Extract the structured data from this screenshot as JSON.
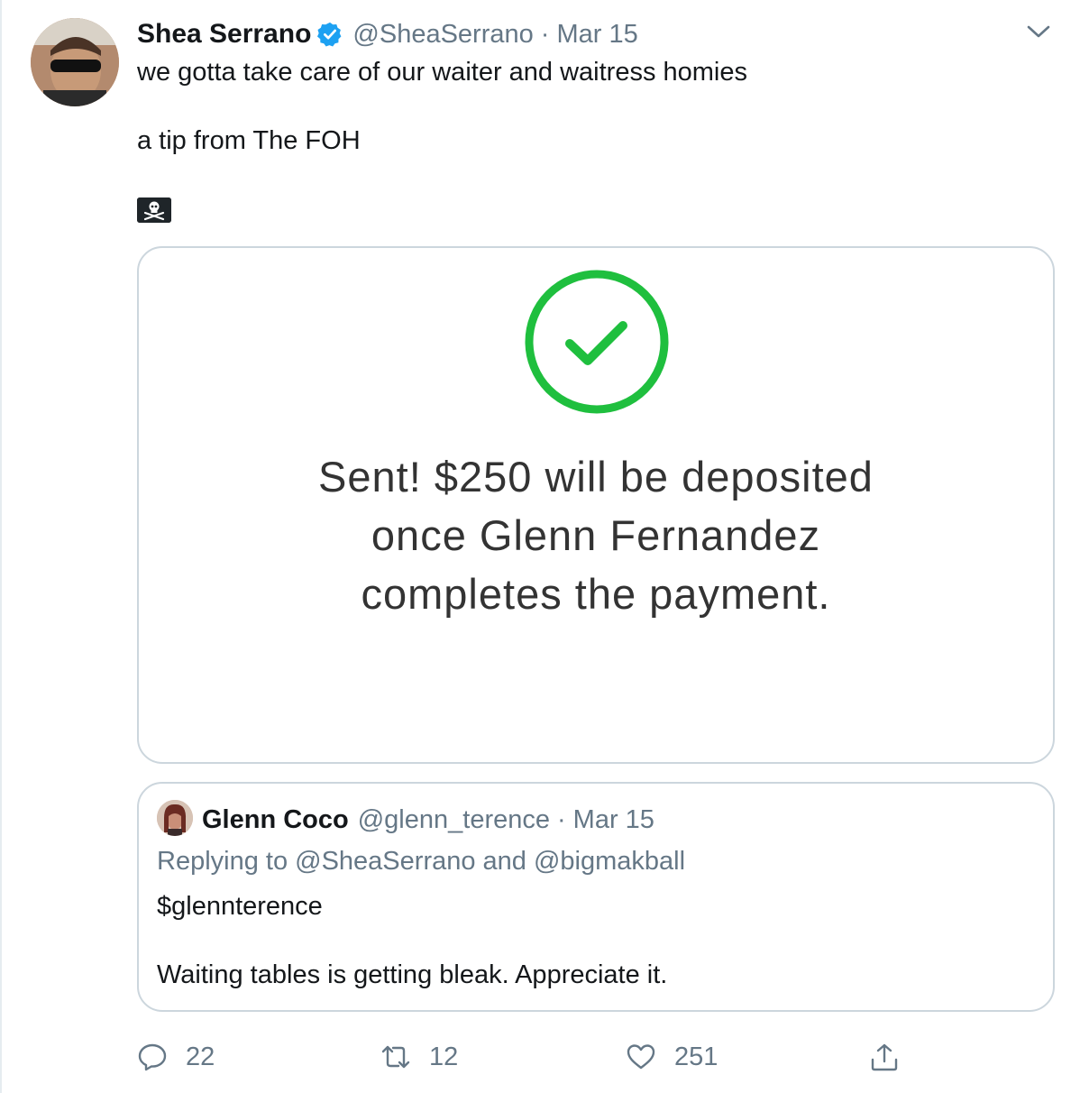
{
  "tweet": {
    "author_name": "Shea Serrano",
    "author_handle": "@SheaSerrano",
    "separator": "·",
    "date": "Mar 15",
    "line1": "we gotta take care of our waiter and waitress homies",
    "line2": "a tip from The FOH",
    "emoji_icon": "pirate-flag-icon",
    "media": {
      "icon": "checkmark-circle-icon",
      "accent_color": "#1fbf3e",
      "lines": [
        "Sent! $250 will be deposited",
        "once Glenn Fernandez",
        "completes the payment."
      ]
    }
  },
  "quoted": {
    "author_name": "Glenn Coco",
    "author_handle": "@glenn_terence",
    "separator": "·",
    "date": "Mar 15",
    "reply_line": "Replying to @SheaSerrano and @bigmakball",
    "line1": "$glennterence",
    "line2": "Waiting tables is getting bleak. Appreciate it."
  },
  "actions": {
    "reply_count": "22",
    "retweet_count": "12",
    "like_count": "251"
  },
  "colors": {
    "verified": "#1da1f2",
    "secondary_text": "#657786",
    "border": "#ccd6dd"
  }
}
